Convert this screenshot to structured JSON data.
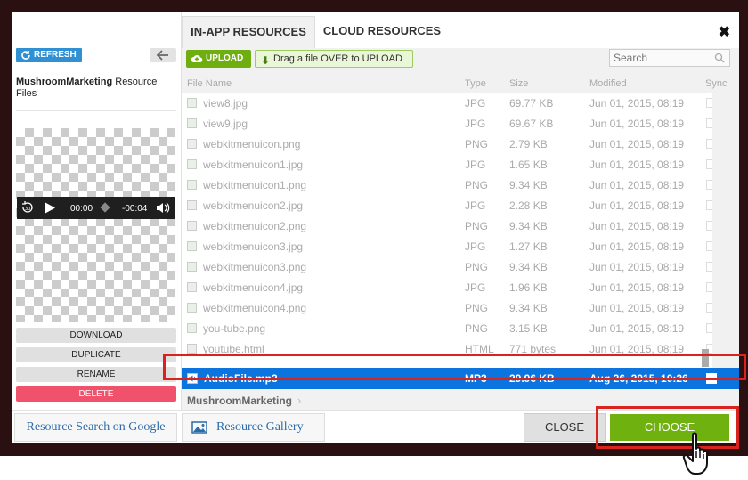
{
  "tabs": [
    {
      "label": "IN-APP RESOURCES",
      "active": true
    },
    {
      "label": "CLOUD RESOURCES",
      "active": false
    }
  ],
  "dialog": {
    "close_glyph": "✖"
  },
  "sidebar": {
    "refresh_label": "REFRESH",
    "resource_owner": "MushroomMarketing",
    "resource_suffix": "Resource Files",
    "player": {
      "current_time": "00:00",
      "duration": "-00:04"
    },
    "actions": {
      "download": "DOWNLOAD",
      "duplicate": "DUPLICATE",
      "rename": "RENAME",
      "delete": "DELETE"
    }
  },
  "toolbar": {
    "upload_label": "UPLOAD",
    "drag_hint": "Drag a file OVER to UPLOAD",
    "search_placeholder": "Search"
  },
  "columns": {
    "name": "File Name",
    "type": "Type",
    "size": "Size",
    "modified": "Modified",
    "sync": "Sync"
  },
  "files": [
    {
      "name": "view8.jpg",
      "type": "JPG",
      "size": "69.77 KB",
      "modified": "Jun 01, 2015, 08:19"
    },
    {
      "name": "view9.jpg",
      "type": "JPG",
      "size": "69.67 KB",
      "modified": "Jun 01, 2015, 08:19"
    },
    {
      "name": "webkitmenuicon.png",
      "type": "PNG",
      "size": "2.79 KB",
      "modified": "Jun 01, 2015, 08:19"
    },
    {
      "name": "webkitmenuicon1.jpg",
      "type": "JPG",
      "size": "1.65 KB",
      "modified": "Jun 01, 2015, 08:19"
    },
    {
      "name": "webkitmenuicon1.png",
      "type": "PNG",
      "size": "9.34 KB",
      "modified": "Jun 01, 2015, 08:19"
    },
    {
      "name": "webkitmenuicon2.jpg",
      "type": "JPG",
      "size": "2.28 KB",
      "modified": "Jun 01, 2015, 08:19"
    },
    {
      "name": "webkitmenuicon2.png",
      "type": "PNG",
      "size": "9.34 KB",
      "modified": "Jun 01, 2015, 08:19"
    },
    {
      "name": "webkitmenuicon3.jpg",
      "type": "JPG",
      "size": "1.27 KB",
      "modified": "Jun 01, 2015, 08:19"
    },
    {
      "name": "webkitmenuicon3.png",
      "type": "PNG",
      "size": "9.34 KB",
      "modified": "Jun 01, 2015, 08:19"
    },
    {
      "name": "webkitmenuicon4.jpg",
      "type": "JPG",
      "size": "1.96 KB",
      "modified": "Jun 01, 2015, 08:19"
    },
    {
      "name": "webkitmenuicon4.png",
      "type": "PNG",
      "size": "9.34 KB",
      "modified": "Jun 01, 2015, 08:19"
    },
    {
      "name": "you-tube.png",
      "type": "PNG",
      "size": "3.15 KB",
      "modified": "Jun 01, 2015, 08:19"
    },
    {
      "name": "youtube.html",
      "type": "HTML",
      "size": "771 bytes",
      "modified": "Jun 01, 2015, 08:19"
    }
  ],
  "selected_file": {
    "name": "AudioFile.mp3",
    "type": "MP3",
    "size": "29.96 KB",
    "modified": "Aug 26, 2015, 10:26"
  },
  "breadcrumb": "MushroomMarketing",
  "footer": {
    "google_label": "Resource Search on Google",
    "gallery_label": "Resource Gallery",
    "close_label": "CLOSE",
    "choose_label": "CHOOSE"
  },
  "colors": {
    "accent_green": "#6fb10f",
    "selection_blue": "#0b74de",
    "delete_red": "#f0526c",
    "highlight_red": "#d9231e",
    "refresh_blue": "#2f91d3"
  }
}
